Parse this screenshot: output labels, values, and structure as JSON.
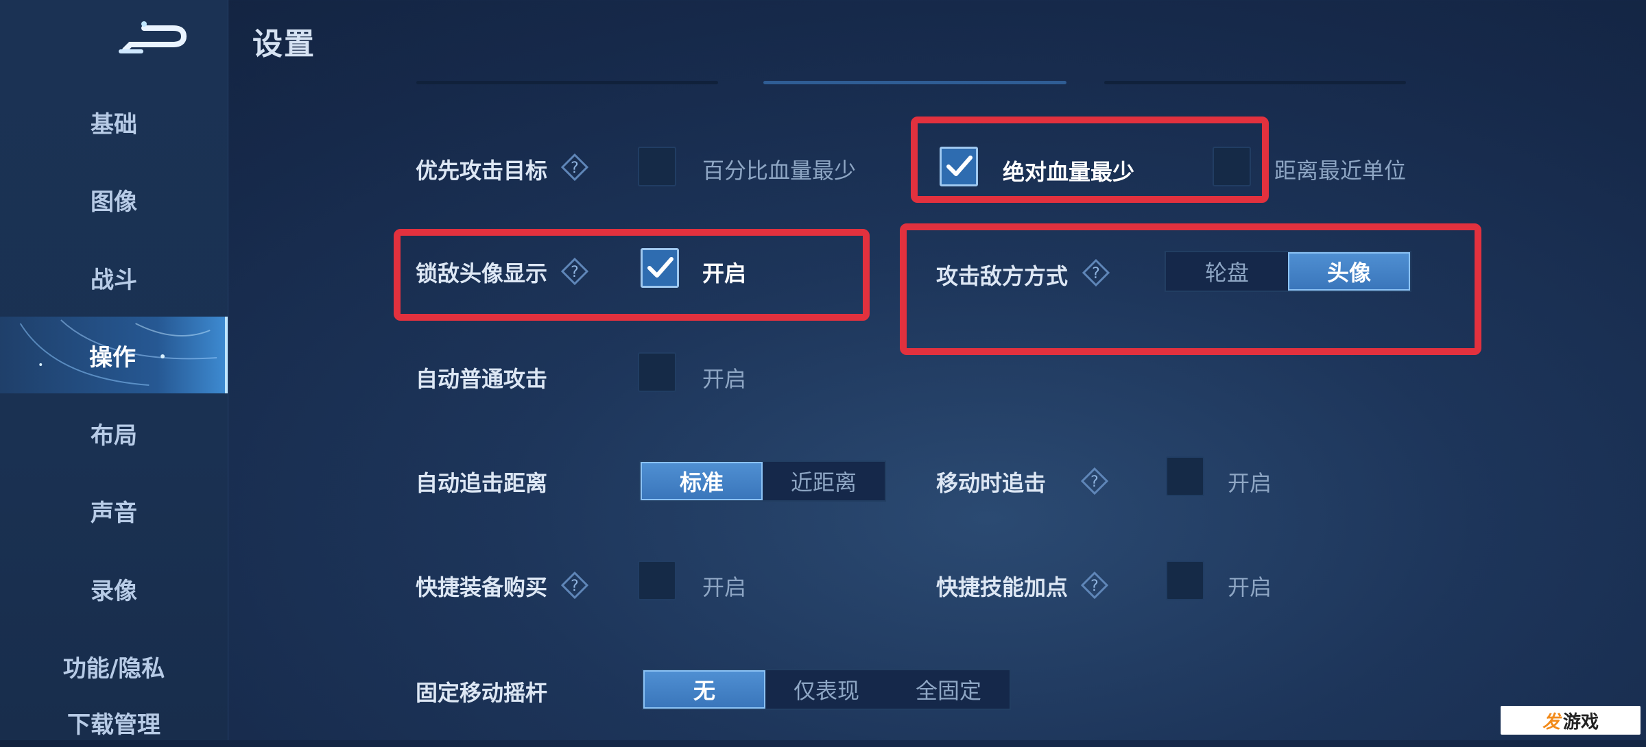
{
  "page": {
    "title": "设置"
  },
  "sidebar": {
    "items": [
      {
        "label": "基础"
      },
      {
        "label": "图像"
      },
      {
        "label": "战斗"
      },
      {
        "label": "操作"
      },
      {
        "label": "布局"
      },
      {
        "label": "声音"
      },
      {
        "label": "录像"
      },
      {
        "label": "功能/隐私"
      },
      {
        "label": "下载管理"
      }
    ],
    "active_index": 3
  },
  "settings": {
    "attack_target": {
      "label": "优先攻击目标",
      "options": [
        {
          "label": "百分比血量最少",
          "checked": false
        },
        {
          "label": "绝对血量最少",
          "checked": true
        },
        {
          "label": "距离最近单位",
          "checked": false
        }
      ]
    },
    "lock_avatar": {
      "label": "锁敌头像显示",
      "option": "开启",
      "checked": true
    },
    "attack_mode": {
      "label": "攻击敌方方式",
      "options": [
        "轮盘",
        "头像"
      ],
      "selected": "头像"
    },
    "auto_attack": {
      "label": "自动普通攻击",
      "option": "开启",
      "checked": false
    },
    "chase_distance": {
      "label": "自动追击距离",
      "options": [
        "标准",
        "近距离"
      ],
      "selected": "标准"
    },
    "move_chase": {
      "label": "移动时追击",
      "option": "开启",
      "checked": false
    },
    "quick_buy": {
      "label": "快捷装备购买",
      "option": "开启",
      "checked": false
    },
    "quick_skill": {
      "label": "快捷技能加点",
      "option": "开启",
      "checked": false
    },
    "fixed_joystick": {
      "label": "固定移动摇杆",
      "options": [
        "无",
        "仅表现",
        "全固定"
      ],
      "selected": "无"
    }
  },
  "watermark": {
    "mark": "发",
    "text": "游戏",
    "url": "www.fayouxi.com"
  },
  "colors": {
    "highlight_box": "#e2313e",
    "accent": "#3a76bb"
  }
}
